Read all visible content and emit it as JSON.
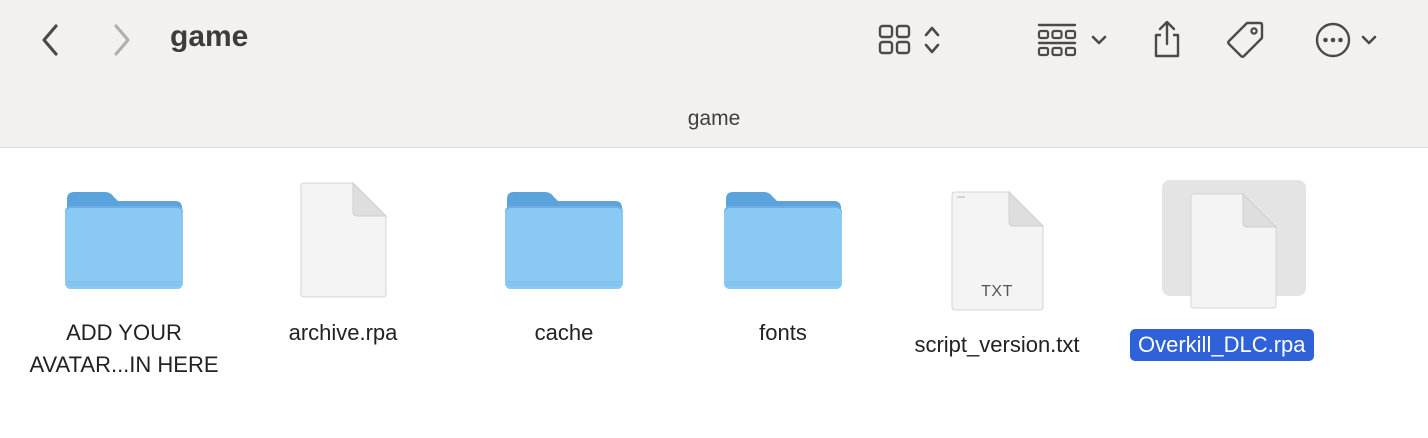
{
  "window": {
    "title": "game"
  },
  "path_bar": {
    "label": "game"
  },
  "toolbar": {
    "back_icon": "chevron-left-icon",
    "forward_icon": "chevron-right-icon",
    "view_icon": "grid-view-icon",
    "group_icon": "group-by-icon",
    "share_icon": "share-icon",
    "tag_icon": "tag-icon",
    "more_icon": "ellipsis-circle-icon"
  },
  "files": [
    {
      "name_line1": "ADD YOUR",
      "name_line2": "AVATAR...IN HERE",
      "kind": "folder"
    },
    {
      "name": "archive.rpa",
      "kind": "document"
    },
    {
      "name": "cache",
      "kind": "folder"
    },
    {
      "name": "fonts",
      "kind": "folder"
    },
    {
      "name": "script_version.txt",
      "kind": "text",
      "badge": "TXT"
    },
    {
      "name": "Overkill_DLC.rpa",
      "kind": "document",
      "selected": true
    }
  ],
  "colors": {
    "selection": "#2f62d8",
    "folder_front": "#89c9f3",
    "folder_back": "#5aa3dc"
  }
}
